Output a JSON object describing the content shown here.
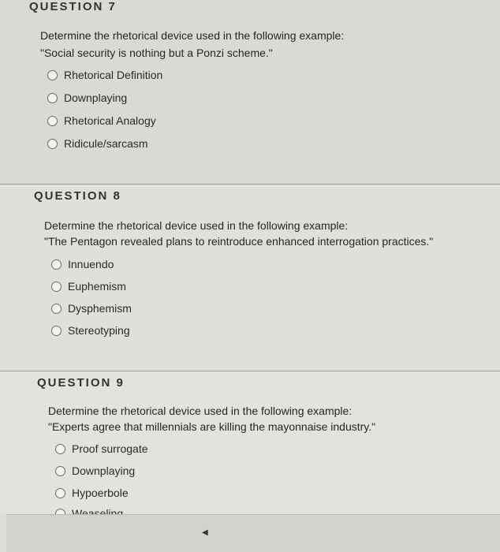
{
  "questions": [
    {
      "header": "QUESTION 7",
      "prompt": "Determine the rhetorical device used in the following example:",
      "example": "\"Social security is nothing but a Ponzi scheme.\"",
      "options": [
        "Rhetorical Definition",
        "Downplaying",
        "Rhetorical Analogy",
        "Ridicule/sarcasm"
      ]
    },
    {
      "header": "QUESTION 8",
      "prompt": "Determine the rhetorical device used in the following example:",
      "example": "\"The Pentagon revealed plans to reintroduce enhanced interrogation practices.\"",
      "options": [
        "Innuendo",
        "Euphemism",
        "Dysphemism",
        "Stereotyping"
      ]
    },
    {
      "header": "QUESTION 9",
      "prompt": "Determine the rhetorical device used in the following example:",
      "example": "\"Experts agree that millennials are killing the mayonnaise industry.\"",
      "options": [
        "Proof surrogate",
        "Downplaying",
        "Hypoerbole",
        "Weaseling"
      ]
    }
  ],
  "colors": {
    "background": "#dcdcd8",
    "bottom_panel": "#d2d3cd"
  }
}
